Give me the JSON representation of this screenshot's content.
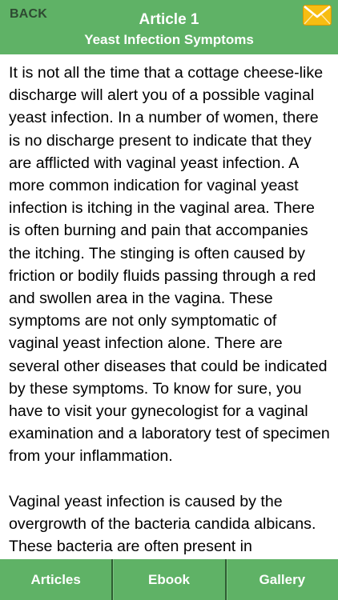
{
  "header": {
    "back_label": "BACK",
    "title": "Article 1",
    "subtitle": "Yeast Infection Symptoms",
    "mail_icon": "envelope-icon"
  },
  "article": {
    "paragraphs": [
      "It is not all the time that a cottage cheese-like discharge will alert you of a possible vaginal yeast infection. In a number of women, there is no discharge present to indicate that they are afflicted with vaginal yeast infection. A more common indication for vaginal yeast infection is itching in the vaginal area. There is often burning and pain that accompanies the itching. The stinging is often caused by friction or bodily fluids passing through a red and swollen area in the vagina. These symptoms are not only symptomatic of vaginal yeast infection alone. There are several other diseases that could be indicated by these symptoms. To know for sure, you have to visit your gynecologist for a vaginal examination and a laboratory test of specimen from your inflammation.",
      "Vaginal yeast infection is caused by the overgrowth of the bacteria candida albicans. These bacteria are often present in"
    ]
  },
  "tabs": {
    "articles": "Articles",
    "ebook": "Ebook",
    "gallery": "Gallery"
  },
  "colors": {
    "bar_green": "#5fb266",
    "back_text": "#2e4a32",
    "envelope": "#f5b800"
  }
}
